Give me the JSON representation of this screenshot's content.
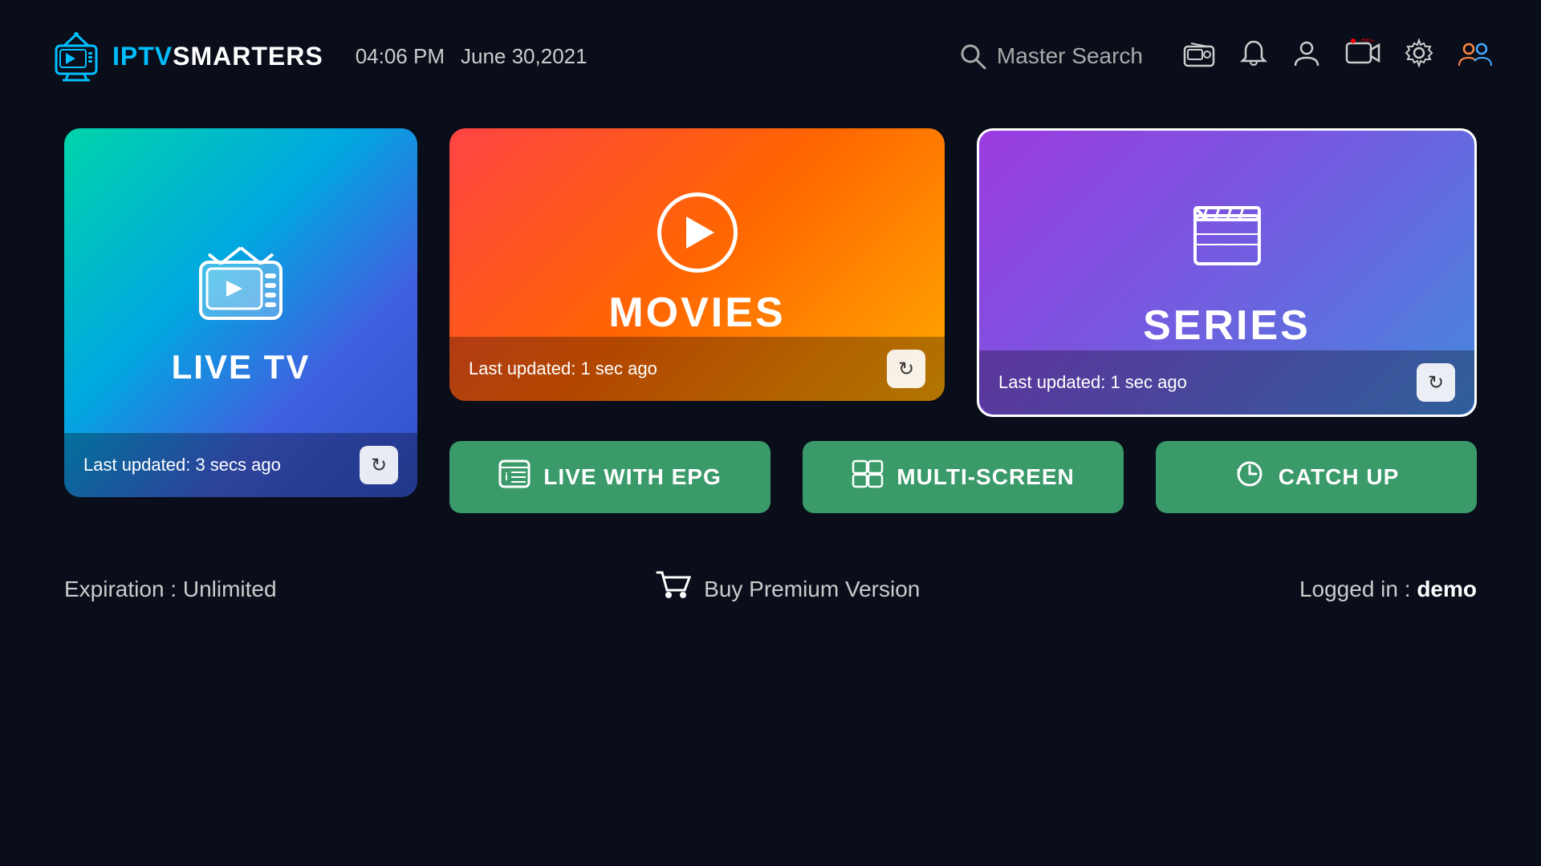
{
  "header": {
    "logo_iptv": "IPTV",
    "logo_smarters": "SMARTERS",
    "time": "04:06 PM",
    "date": "June 30,2021",
    "search_placeholder": "Master Search",
    "nav_icons": [
      "radio-icon",
      "bell-icon",
      "user-icon",
      "record-icon",
      "settings-icon",
      "profile-switch-icon"
    ]
  },
  "cards": {
    "live_tv": {
      "label": "LIVE TV",
      "last_updated": "Last updated: 3 secs ago"
    },
    "movies": {
      "label": "MOVIES",
      "last_updated": "Last updated: 1 sec ago"
    },
    "series": {
      "label": "SERIES",
      "last_updated": "Last updated: 1 sec ago"
    }
  },
  "buttons": {
    "live_epg": "LIVE WITH EPG",
    "multi_screen": "MULTI-SCREEN",
    "catch_up": "CATCH UP"
  },
  "footer": {
    "expiration": "Expiration : Unlimited",
    "buy_premium": "Buy Premium Version",
    "logged_in_label": "Logged in : ",
    "logged_in_user": "demo"
  }
}
